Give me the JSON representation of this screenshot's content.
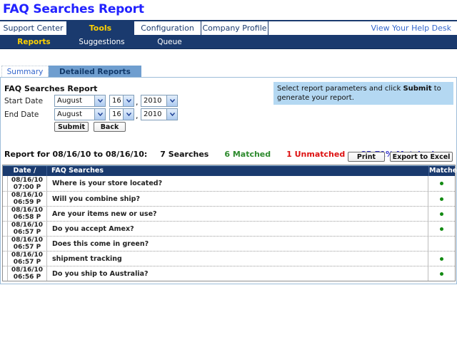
{
  "page": {
    "title": "FAQ Searches Report"
  },
  "nav": {
    "items": [
      {
        "label": "Support Center",
        "active": false
      },
      {
        "label": "Tools",
        "active": true
      },
      {
        "label": "Configuration",
        "active": false
      },
      {
        "label": "Company Profile",
        "active": false
      }
    ],
    "right_link": "View Your Help Desk",
    "sub_items": [
      {
        "label": "Reports",
        "active": true
      },
      {
        "label": "Suggestions",
        "active": false
      },
      {
        "label": "Queue",
        "active": false
      }
    ]
  },
  "tabs": [
    {
      "label": "Summary",
      "active": false
    },
    {
      "label": "Detailed Reports",
      "active": true
    }
  ],
  "form": {
    "heading": "FAQ Searches Report",
    "start_date": {
      "label": "Start Date",
      "month": "August",
      "day": "16",
      "year": "2010"
    },
    "end_date": {
      "label": "End Date",
      "month": "August",
      "day": "16",
      "year": "2010"
    },
    "date_separator": ",",
    "submit_label": "Submit",
    "back_label": "Back",
    "instructions_prefix": "Select report parameters and click ",
    "instructions_bold": "Submit",
    "instructions_suffix": " to generate your report."
  },
  "report": {
    "title": "Report for 08/16/10 to 08/16/10:",
    "searches": "7 Searches",
    "matched": "6 Matched",
    "unmatched": "1 Unmatched",
    "percent": "85.71% Matched",
    "print_label": "Print",
    "export_label": "Export to Excel"
  },
  "table": {
    "headers": {
      "date": "Date / Time",
      "faq": "FAQ Searches",
      "matched": "Matched"
    },
    "rows": [
      {
        "date": "08/16/10",
        "time": "07:00 P",
        "query": "Where is your store located?",
        "matched": true
      },
      {
        "date": "08/16/10",
        "time": "06:59 P",
        "query": "Will you combine ship?",
        "matched": true
      },
      {
        "date": "08/16/10",
        "time": "06:58 P",
        "query": "Are your items new or use?",
        "matched": true
      },
      {
        "date": "08/16/10",
        "time": "06:57 P",
        "query": "Do you accept Amex?",
        "matched": true
      },
      {
        "date": "08/16/10",
        "time": "06:57 P",
        "query": "Does this come in green?",
        "matched": false
      },
      {
        "date": "08/16/10",
        "time": "06:57 P",
        "query": "shipment tracking",
        "matched": true
      },
      {
        "date": "08/16/10",
        "time": "06:56 P",
        "query": "Do you ship to Australia?",
        "matched": true
      }
    ]
  },
  "colors": {
    "navy": "#1a3a6e",
    "yellow": "#ffd200",
    "tab-blue": "#6f9ecf",
    "box-blue": "#b4d8f2",
    "panel-border": "#9dbdd9",
    "title-blue": "#2222ff",
    "link-blue": "#3366cc",
    "green-text": "#2d8a2d",
    "dot-green": "#128a12",
    "red-text": "#dd1111",
    "pct-blue": "#3333cc",
    "header-hl": "#7fa9d2"
  }
}
